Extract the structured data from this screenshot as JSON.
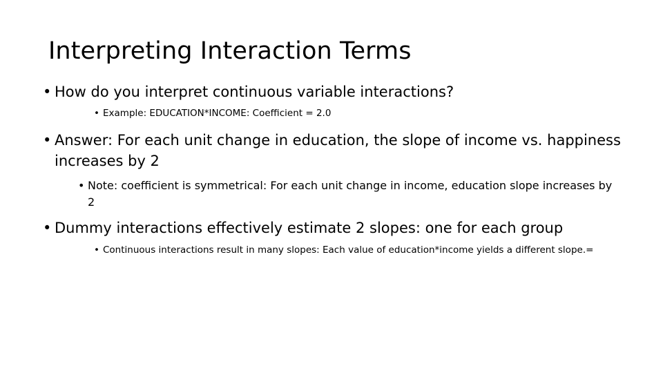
{
  "slide": {
    "title": "Interpreting Interaction Terms",
    "background_color": "#ffffff",
    "text_color": "#000000",
    "bullet_glyph": "•",
    "content": [
      {
        "level": 1,
        "text": "How do you interpret continuous variable interactions?"
      },
      {
        "level": 2,
        "text": "Example:  EDUCATION*INCOME:  Coefficient = 2.0"
      },
      {
        "level": 1,
        "text": "Answer:  For each unit change in education, the slope of income vs. happiness increases by 2"
      },
      {
        "level": 2,
        "text": "Note:  coefficient is symmetrical:  For each unit change in income, education slope increases by 2"
      },
      {
        "level": 1,
        "text": "Dummy interactions effectively estimate 2 slopes:  one for each group"
      },
      {
        "level": 2,
        "text": "Continuous interactions result in many slopes:  Each value of education*income yields a different slope.="
      }
    ]
  }
}
